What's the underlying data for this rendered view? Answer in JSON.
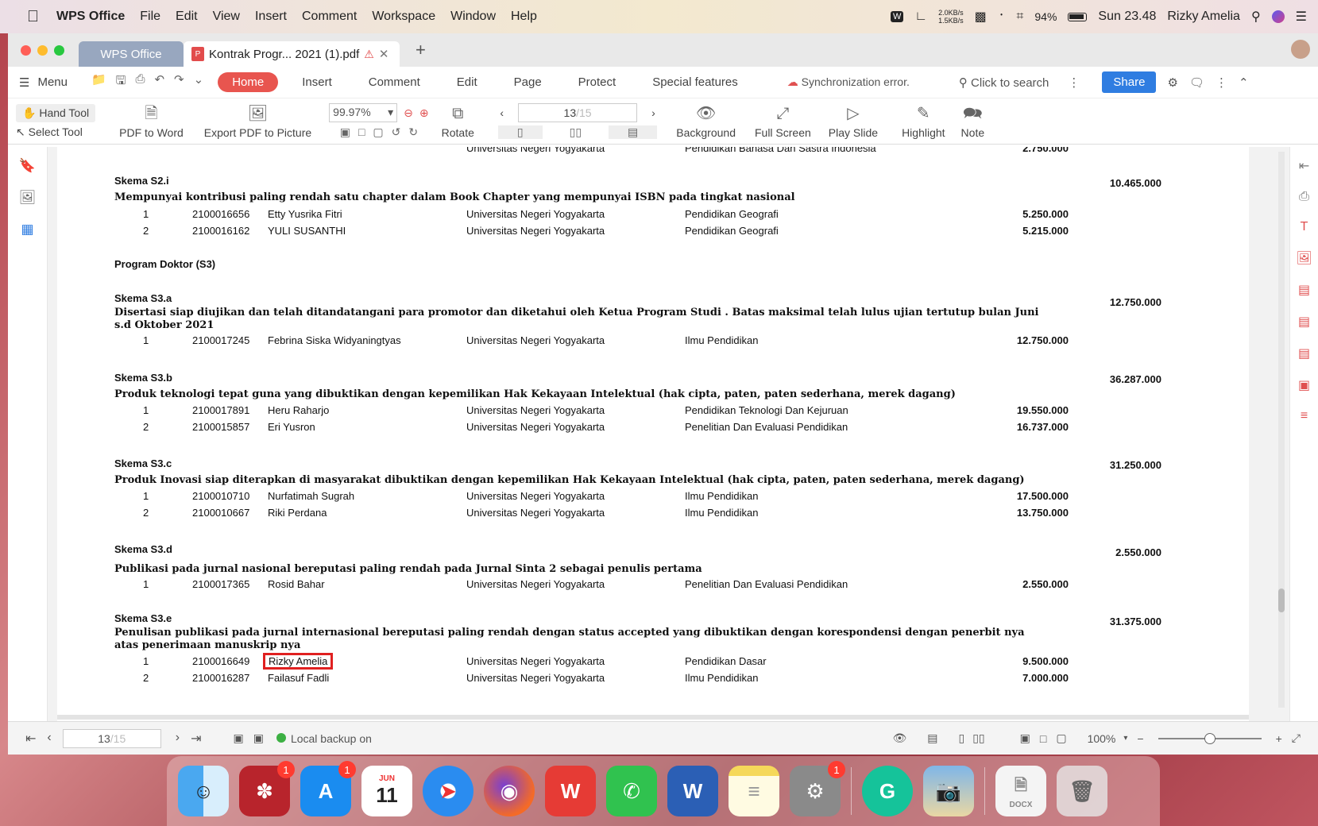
{
  "menubar": {
    "app": "WPS Office",
    "items": [
      "File",
      "Edit",
      "View",
      "Insert",
      "Comment",
      "Workspace",
      "Window",
      "Help"
    ],
    "net_up": "2.0KB/s",
    "net_down": "1.5KB/s",
    "battery": "94%",
    "clock": "Sun 23.48",
    "user": "Rizky Amelia"
  },
  "tabs": {
    "app_tab": "WPS Office",
    "doc_tab": "Kontrak Progr... 2021 (1).pdf"
  },
  "ribbon": {
    "menu": "Menu",
    "tabs": [
      "Home",
      "Insert",
      "Comment",
      "Edit",
      "Page",
      "Protect",
      "Special features"
    ],
    "sync": "Synchronization error.",
    "search": "Click to search",
    "share": "Share"
  },
  "toolbar": {
    "hand": "Hand Tool",
    "select": "Select Tool",
    "pdf_to_word": "PDF to Word",
    "export": "Export PDF to Picture",
    "zoom": "99.97%",
    "rotate": "Rotate",
    "page_current": "13",
    "page_total": "/15",
    "background": "Background",
    "full_screen": "Full Screen",
    "play_slide": "Play Slide",
    "highlight": "Highlight",
    "note": "Note"
  },
  "document": {
    "top_partial": {
      "univ": "Universitas Negeri Yogyakarta",
      "prodi": "Pendidikan Bahasa Dan Sastra Indonesia",
      "amount": "2.750.000"
    },
    "program_s3": "Program Doktor (S3)",
    "sections": [
      {
        "title": "Skema S2.i",
        "desc": "Mempunyai kontribusi paling rendah satu chapter dalam Book Chapter yang mempunyai ISBN pada tingkat nasional",
        "total": "10.465.000",
        "rows": [
          {
            "no": "1",
            "nim": "2100016656",
            "name": "Etty Yusrika Fitri",
            "univ": "Universitas Negeri Yogyakarta",
            "prodi": "Pendidikan Geografi",
            "amount": "5.250.000"
          },
          {
            "no": "2",
            "nim": "2100016162",
            "name": "YULI SUSANTHI",
            "univ": "Universitas Negeri Yogyakarta",
            "prodi": "Pendidikan Geografi",
            "amount": "5.215.000"
          }
        ]
      },
      {
        "title": "Skema S3.a",
        "desc": "Disertasi siap diujikan dan telah ditandatangani para promotor dan diketahui oleh Ketua Program Studi . Batas maksimal telah lulus ujian tertutup bulan Juni s.d Oktober 2021",
        "total": "12.750.000",
        "rows": [
          {
            "no": "1",
            "nim": "2100017245",
            "name": "Febrina Siska Widyaningtyas",
            "univ": "Universitas Negeri Yogyakarta",
            "prodi": "Ilmu Pendidikan",
            "amount": "12.750.000"
          }
        ]
      },
      {
        "title": "Skema S3.b",
        "desc": "Produk teknologi tepat guna yang dibuktikan dengan kepemilikan Hak Kekayaan Intelektual (hak cipta, paten, paten sederhana, merek dagang)",
        "total": "36.287.000",
        "rows": [
          {
            "no": "1",
            "nim": "2100017891",
            "name": "Heru Raharjo",
            "univ": "Universitas Negeri Yogyakarta",
            "prodi": "Pendidikan Teknologi Dan Kejuruan",
            "amount": "19.550.000"
          },
          {
            "no": "2",
            "nim": "2100015857",
            "name": "Eri Yusron",
            "univ": "Universitas Negeri Yogyakarta",
            "prodi": "Penelitian Dan Evaluasi Pendidikan",
            "amount": "16.737.000"
          }
        ]
      },
      {
        "title": "Skema S3.c",
        "desc": "Produk Inovasi siap diterapkan di masyarakat dibuktikan dengan kepemilikan Hak Kekayaan Intelektual (hak cipta, paten, paten sederhana, merek dagang)",
        "total": "31.250.000",
        "rows": [
          {
            "no": "1",
            "nim": "2100010710",
            "name": "Nurfatimah Sugrah",
            "univ": "Universitas Negeri Yogyakarta",
            "prodi": "Ilmu Pendidikan",
            "amount": "17.500.000"
          },
          {
            "no": "2",
            "nim": "2100010667",
            "name": "Riki Perdana",
            "univ": "Universitas Negeri Yogyakarta",
            "prodi": "Ilmu Pendidikan",
            "amount": "13.750.000"
          }
        ]
      },
      {
        "title": "Skema S3.d",
        "desc": "Publikasi pada jurnal nasional bereputasi paling rendah pada Jurnal Sinta 2 sebagai penulis pertama",
        "total": "2.550.000",
        "rows": [
          {
            "no": "1",
            "nim": "2100017365",
            "name": "Rosid Bahar",
            "univ": "Universitas Negeri Yogyakarta",
            "prodi": "Penelitian Dan Evaluasi Pendidikan",
            "amount": "2.550.000"
          }
        ]
      },
      {
        "title": "Skema S3.e",
        "desc": "Penulisan publikasi pada jurnal internasional bereputasi paling rendah dengan status accepted yang dibuktikan dengan korespondensi dengan penerbit nya atas penerimaan manuskrip nya",
        "total": "31.375.000",
        "rows": [
          {
            "no": "1",
            "nim": "2100016649",
            "name": "Rizky Amelia",
            "univ": "Universitas Negeri Yogyakarta",
            "prodi": "Pendidikan Dasar",
            "amount": "9.500.000"
          },
          {
            "no": "2",
            "nim": "2100016287",
            "name": "Failasuf Fadli",
            "univ": "Universitas Negeri Yogyakarta",
            "prodi": "Ilmu Pendidikan",
            "amount": "7.000.000"
          }
        ]
      }
    ]
  },
  "statusbar": {
    "page_current": "13",
    "page_total": "/15",
    "backup": "Local backup on",
    "zoom": "100%"
  },
  "dock": {
    "calendar_month": "JUN",
    "calendar_day": "11",
    "appstore_badge": "1",
    "mendeley_badge": "1",
    "prefs_badge": "1",
    "docx_label": "DOCX"
  },
  "colors": {
    "accent_red": "#e8554f",
    "share_blue": "#2f7de1",
    "highlight_box": "#e02020"
  }
}
